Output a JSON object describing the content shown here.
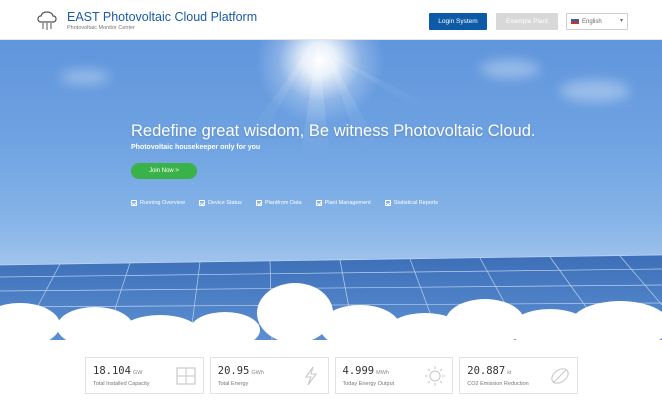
{
  "header": {
    "brand_title": "EAST Photovoltaic Cloud Platform",
    "brand_sub": "Photovoltaic Monitor Center",
    "login_label": "Login System",
    "example_label": "Example Plant",
    "language": "English"
  },
  "hero": {
    "title": "Redefine great wisdom, Be witness Photovoltaic Cloud.",
    "subtitle": "Photovoltaic housekeeper only for you",
    "join_label": "Join Now >",
    "features": [
      "Running Overview",
      "Device Status",
      "Plantfrom Data",
      "Plant Management",
      "Statistical Reports"
    ]
  },
  "stats": [
    {
      "value": "18.104",
      "unit": "GW",
      "label": "Total Installed Capacity",
      "icon": "grid-panel-icon"
    },
    {
      "value": "20.95",
      "unit": "GWh",
      "label": "Total Energy",
      "icon": "lightning-icon"
    },
    {
      "value": "4.999",
      "unit": "MWh",
      "label": "Today Energy Output",
      "icon": "sun-icon"
    },
    {
      "value": "20.887",
      "unit": "kt",
      "label": "CO2 Emission Reduction",
      "icon": "leaf-icon"
    }
  ],
  "colors": {
    "brand": "#1c5aa8",
    "login_button": "#0d5aa7",
    "join_button": "#3ab24a",
    "sky": "#6fa3e2"
  }
}
